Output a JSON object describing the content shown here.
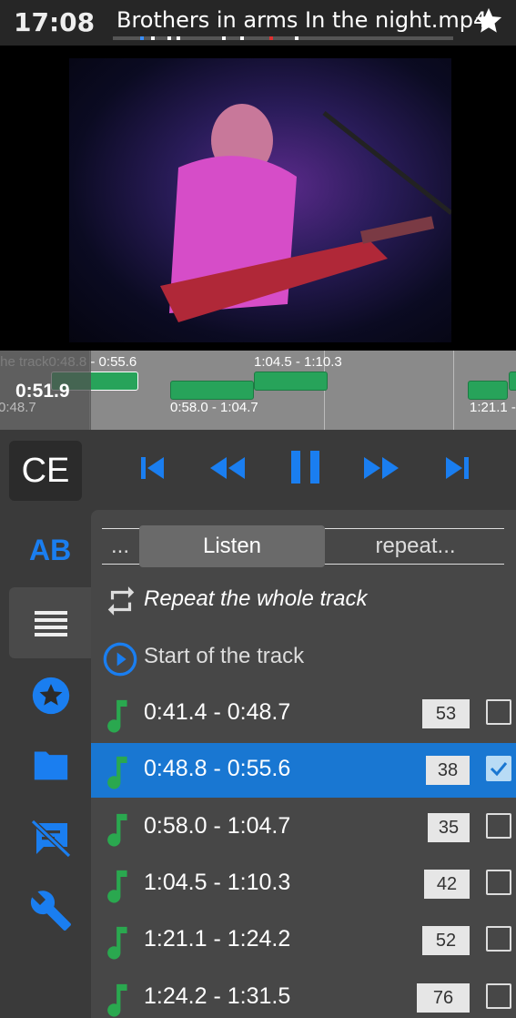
{
  "header": {
    "clock": "17:08",
    "title": "Brothers in arms In the night.mp4",
    "star_icon": "star-icon"
  },
  "timeline": {
    "current_time": "0:51.9",
    "labels": {
      "left_top": "the track0:48.8 - 0:55.6",
      "left_bottom": "0:48.7",
      "seg_top": "1:04.5 - 1:10.3",
      "seg_bottom": "0:58.0 - 1:04.7",
      "right_bottom": "1:21.1 -"
    }
  },
  "controls": {
    "ce_label": "CE",
    "icons": [
      "skip-previous-icon",
      "rewind-icon",
      "pause-icon",
      "fast-forward-icon",
      "skip-next-icon"
    ]
  },
  "sidebar": {
    "ab_label": "AB",
    "icons": [
      "list-icon",
      "star-circle-icon",
      "folder-icon",
      "subtitles-off-icon",
      "wrench-icon"
    ]
  },
  "tabs": {
    "more": "...",
    "listen": "Listen",
    "repeat": "repeat..."
  },
  "list": {
    "repeat_whole": "Repeat the whole track",
    "start_track": "Start of the track",
    "segments": [
      {
        "label": "0:41.4 - 0:48.7",
        "count": "53",
        "checked": false
      },
      {
        "label": "0:48.8 - 0:55.6",
        "count": "38",
        "checked": true
      },
      {
        "label": "0:58.0 - 1:04.7",
        "count": "35",
        "checked": false
      },
      {
        "label": "1:04.5 - 1:10.3",
        "count": "42",
        "checked": false
      },
      {
        "label": "1:21.1 - 1:24.2",
        "count": "52",
        "checked": false
      },
      {
        "label": "1:24.2 - 1:31.5",
        "count": "76",
        "checked": false
      }
    ]
  },
  "colors": {
    "accent": "#1a7ef0",
    "selected_row": "#1977d2",
    "segment_green": "#27a35a",
    "note_green": "#2aa84f"
  }
}
